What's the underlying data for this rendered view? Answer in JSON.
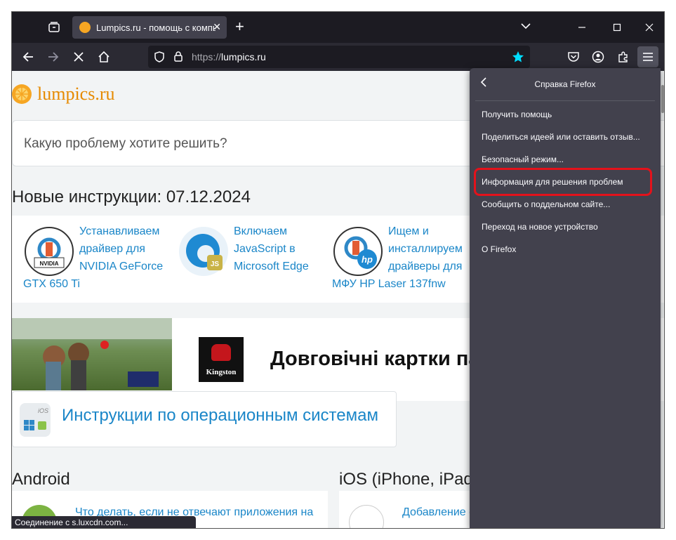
{
  "browser": {
    "tab_title": "Lumpics.ru - помощь с компь",
    "url_protocol": "https://",
    "url_host": "lumpics.ru",
    "status_text": "Соединение с s.luxcdn.com..."
  },
  "page": {
    "logo_text": "lumpics.ru",
    "search_placeholder": "Какую проблему хотите решить?",
    "news_heading": "Новые инструкции: 07.12.2024",
    "cards": [
      {
        "title_lines": [
          "Устанавливаем",
          "драйвер для",
          "NVIDIA GeForce"
        ],
        "tail": "GTX 650 Ti",
        "icon": "nvidia-driver-icon",
        "icon_label": "NVIDIA"
      },
      {
        "title_lines": [
          "Включаем",
          "JavaScript в",
          "Microsoft Edge"
        ],
        "tail": "",
        "icon": "edge-js-icon",
        "icon_label": "JS"
      },
      {
        "title_lines": [
          "Ищем и",
          "инсталлируем",
          "драйверы для"
        ],
        "tail": "МФУ HP Laser 137fnw",
        "icon": "hp-driver-icon",
        "icon_label": "hp"
      }
    ],
    "ad": {
      "brand": "Kingston",
      "headline": "Довговічні картки па"
    },
    "os_section": {
      "label": "Инструкции по операционным системам",
      "icon_label": "iOS"
    },
    "columns": [
      {
        "heading": "Android",
        "first_item": "Что делать, если не отвечают приложения на"
      },
      {
        "heading": "iOS (iPhone, iPad)",
        "first_item": "Добавление с"
      }
    ]
  },
  "panel": {
    "title": "Справка Firefox",
    "items": [
      "Получить помощь",
      "Поделиться идеей или оставить отзыв...",
      "Безопасный режим...",
      "Информация для решения проблем",
      "Сообщить о поддельном сайте...",
      "Переход на новое устройство",
      "О Firefox"
    ],
    "highlight_index": 3
  },
  "colors": {
    "accent": "#1a86c8",
    "logo": "#e68a00",
    "highlight": "#e4121b",
    "panel_bg": "#42414d",
    "toolbar_bg": "#2b2a33",
    "star": "#00ddff"
  }
}
